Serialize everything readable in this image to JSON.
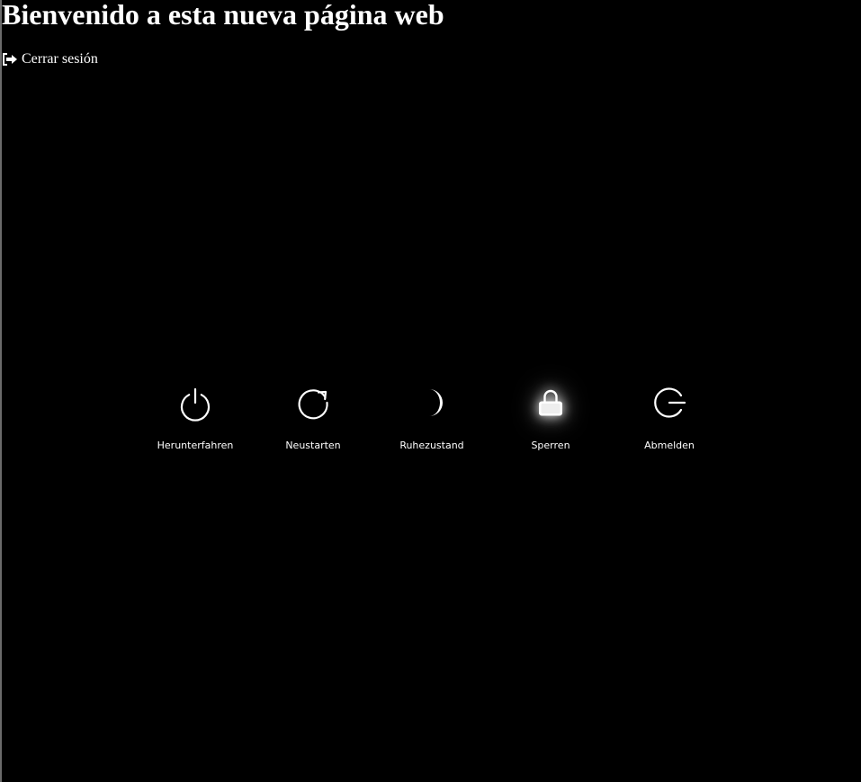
{
  "page": {
    "title": "Bienvenido a esta nueva página web",
    "logout_label": "Cerrar sesión",
    "logout_icon": "sign-out-icon"
  },
  "power_menu": {
    "items": [
      {
        "label": "Herunterfahren",
        "icon": "power-icon"
      },
      {
        "label": "Neustarten",
        "icon": "restart-icon"
      },
      {
        "label": "Ruhezustand",
        "icon": "moon-icon"
      },
      {
        "label": "Sperren",
        "icon": "lock-icon",
        "highlighted": true
      },
      {
        "label": "Abmelden",
        "icon": "logout-icon"
      }
    ]
  },
  "colors": {
    "background": "#000000",
    "text": "#ffffff",
    "left_edge": "#6b6b6b"
  }
}
